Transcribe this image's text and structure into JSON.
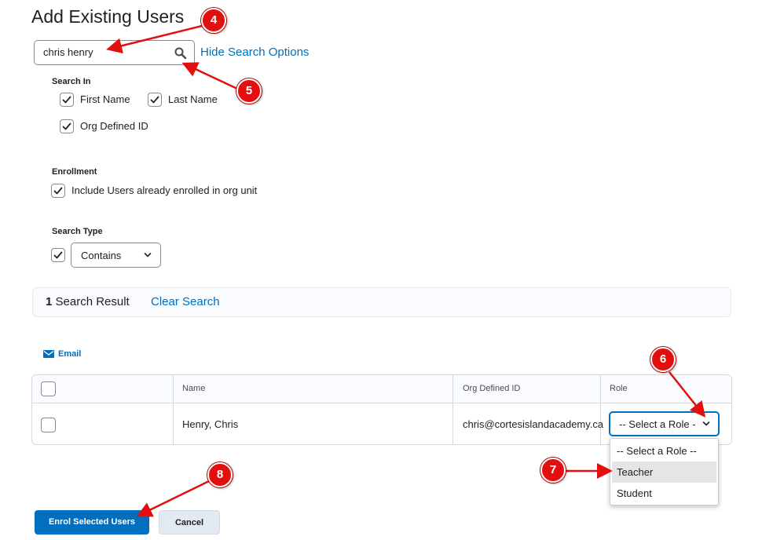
{
  "page": {
    "title": "Add Existing Users"
  },
  "search": {
    "value": "chris henry",
    "hide_options_label": "Hide Search Options"
  },
  "search_in": {
    "label": "Search In",
    "options": [
      {
        "label": "First Name",
        "checked": true
      },
      {
        "label": "Last Name",
        "checked": true
      },
      {
        "label": "Org Defined ID",
        "checked": true
      }
    ]
  },
  "enrollment": {
    "label": "Enrollment",
    "option": {
      "label": "Include Users already enrolled in org unit",
      "checked": true
    }
  },
  "search_type": {
    "label": "Search Type",
    "selected": "Contains",
    "checked": true
  },
  "results": {
    "count": "1",
    "text": "Search Result",
    "clear_label": "Clear Search"
  },
  "email": {
    "label": "Email"
  },
  "table": {
    "columns": [
      "Name",
      "Org Defined ID",
      "Role"
    ],
    "rows": [
      {
        "name": "Henry, Chris",
        "org_id": "chris@cortesislandacademy.ca",
        "role": "-- Select a Role -"
      }
    ]
  },
  "role_dropdown": {
    "options": [
      "-- Select a Role --",
      "Teacher",
      "Student"
    ],
    "highlighted": "Teacher"
  },
  "buttons": {
    "enrol": "Enrol Selected Users",
    "cancel": "Cancel"
  },
  "annotations": [
    "4",
    "5",
    "6",
    "7",
    "8"
  ],
  "colors": {
    "accent": "#006fbf",
    "marker": "#e30f0f"
  }
}
